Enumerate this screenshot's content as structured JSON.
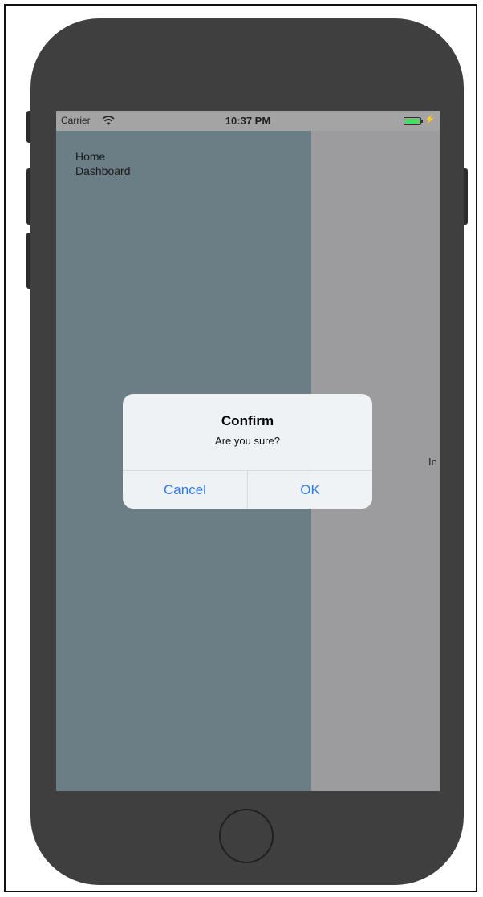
{
  "status_bar": {
    "carrier": "Carrier",
    "time": "10:37 PM",
    "wifi_icon": "wifi-icon",
    "battery_icon": "battery-icon",
    "charge_icon": "charging-bolt-icon",
    "charge_glyph": "⚡"
  },
  "drawer": {
    "items": [
      {
        "label": "Home"
      },
      {
        "label": "Dashboard"
      }
    ]
  },
  "main": {
    "peek_text": "In"
  },
  "alert": {
    "title": "Confirm",
    "message": "Are you sure?",
    "cancel_label": "Cancel",
    "ok_label": "OK"
  },
  "colors": {
    "drawer_bg": "#6b7e85",
    "overlay_bg": "#9c9c9e",
    "alert_button": "#2f7bf5",
    "device_body": "#3f3f3f"
  }
}
